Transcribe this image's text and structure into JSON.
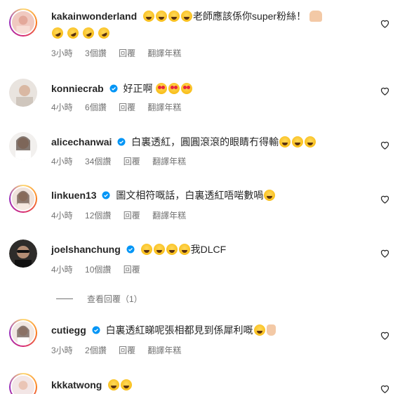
{
  "comments": [
    {
      "username": "kakainwonderland",
      "verified": false,
      "text_before": "",
      "text": "老師應該係你super粉絲！",
      "time": "3小時",
      "likes": "3個讚",
      "reply": "回覆",
      "translate": "翻譯年糕"
    },
    {
      "username": "konniecrab",
      "verified": true,
      "text": "好正啊",
      "time": "4小時",
      "likes": "6個讚",
      "reply": "回覆",
      "translate": "翻譯年糕"
    },
    {
      "username": "alicechanwai",
      "verified": true,
      "text": "白裏透紅，圓圓滾滾的眼睛冇得輸",
      "time": "4小時",
      "likes": "34個讚",
      "reply": "回覆",
      "translate": "翻譯年糕"
    },
    {
      "username": "linkuen13",
      "verified": true,
      "text": "圖文相符嘅話，白裏透紅唔啱數喎",
      "time": "4小時",
      "likes": "12個讚",
      "reply": "回覆",
      "translate": "翻譯年糕"
    },
    {
      "username": "joelshanchung",
      "verified": true,
      "text": "我DLCF",
      "time": "4小時",
      "likes": "10個讚",
      "reply": "回覆",
      "translate": ""
    },
    {
      "username": "cutiegg",
      "verified": true,
      "text": "白裏透紅睇呢張相都見到係犀利嘅",
      "time": "3小時",
      "likes": "2個讚",
      "reply": "回覆",
      "translate": "翻譯年糕"
    },
    {
      "username": "kkkatwong",
      "verified": false,
      "text": "",
      "time": "",
      "likes": "",
      "reply": "",
      "translate": ""
    }
  ],
  "view_replies": "查看回覆（1）",
  "icons": {
    "like": "heart-outline-icon",
    "verified": "verified-badge-icon"
  },
  "colors": {
    "verified": "#0095f6",
    "meta_text": "#737373",
    "username": "#262626"
  }
}
